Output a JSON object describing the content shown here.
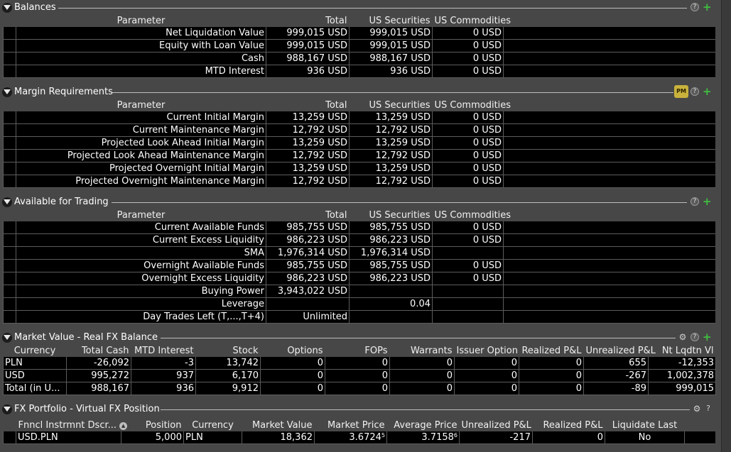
{
  "balances": {
    "title": "Balances",
    "headers": [
      "Parameter",
      "Total",
      "US Securities",
      "US Commodities"
    ],
    "rows": [
      [
        "Net Liquidation Value",
        "999,015 USD",
        "999,015 USD",
        "0 USD"
      ],
      [
        "Equity with Loan Value",
        "999,015 USD",
        "999,015 USD",
        "0 USD"
      ],
      [
        "Cash",
        "988,167 USD",
        "988,167 USD",
        "0 USD"
      ],
      [
        "MTD Interest",
        "936 USD",
        "936 USD",
        "0 USD"
      ]
    ]
  },
  "margin": {
    "title": "Margin Requirements",
    "try_label": "PM",
    "headers": [
      "Parameter",
      "Total",
      "US Securities",
      "US Commodities"
    ],
    "rows": [
      [
        "Current Initial Margin",
        "13,259 USD",
        "13,259 USD",
        "0 USD"
      ],
      [
        "Current Maintenance Margin",
        "12,792 USD",
        "12,792 USD",
        "0 USD"
      ],
      [
        "Projected Look Ahead Initial Margin",
        "13,259 USD",
        "13,259 USD",
        "0 USD"
      ],
      [
        "Projected Look Ahead Maintenance Margin",
        "12,792 USD",
        "12,792 USD",
        "0 USD"
      ],
      [
        "Projected Overnight Initial Margin",
        "13,259 USD",
        "13,259 USD",
        "0 USD"
      ],
      [
        "Projected Overnight Maintenance Margin",
        "12,792 USD",
        "12,792 USD",
        "0 USD"
      ]
    ]
  },
  "available": {
    "title": "Available for Trading",
    "headers": [
      "Parameter",
      "Total",
      "US Securities",
      "US Commodities"
    ],
    "rows": [
      [
        "Current Available Funds",
        "985,755 USD",
        "985,755 USD",
        "0 USD"
      ],
      [
        "Current Excess Liquidity",
        "986,223 USD",
        "986,223 USD",
        "0 USD"
      ],
      [
        "SMA",
        "1,976,314 USD",
        "1,976,314 USD",
        ""
      ],
      [
        "Overnight Available Funds",
        "985,755 USD",
        "985,755 USD",
        "0 USD"
      ],
      [
        "Overnight Excess Liquidity",
        "986,223 USD",
        "986,223 USD",
        "0 USD"
      ],
      [
        "Buying Power",
        "3,943,022 USD",
        "",
        ""
      ],
      [
        "Leverage",
        "",
        "0.04",
        ""
      ],
      [
        "Day Trades Left (T,...,T+4)",
        "Unlimited",
        "",
        ""
      ]
    ]
  },
  "market": {
    "title": "Market Value - Real FX Balance",
    "headers": [
      "Currency",
      "Total Cash",
      "MTD Interest",
      "Stock",
      "Options",
      "FOPs",
      "Warrants",
      "Issuer Option",
      "Realized P&L",
      "Unrealized P&L",
      "Nt Lqdtn Vl"
    ],
    "rows": [
      [
        "PLN",
        "-26,092",
        "-3",
        "13,742",
        "0",
        "0",
        "0",
        "0",
        "0",
        "655",
        "-12,353"
      ],
      [
        "USD",
        "995,272",
        "937",
        "6,170",
        "0",
        "0",
        "0",
        "0",
        "0",
        "-267",
        "1,002,378"
      ],
      [
        "Total (in U...",
        "988,167",
        "936",
        "9,912",
        "0",
        "0",
        "0",
        "0",
        "0",
        "-89",
        "999,015"
      ]
    ]
  },
  "fx": {
    "title": "FX Portfolio - Virtual FX Position",
    "headers": [
      "Fnncl Instrmnt Dscr...",
      "Position",
      "Currency",
      "Market Value",
      "Market Price",
      "Average Price",
      "Unrealized P&L",
      "Realized P&L",
      "Liquidate Last"
    ],
    "row": {
      "instrument": "USD.PLN",
      "position": "5,000",
      "currency": "PLN",
      "market_value": "18,362",
      "market_price": "3.6724",
      "market_price_sup": "5",
      "average_price": "3.7158",
      "average_price_sup": "6",
      "unrealized": "-217",
      "realized": "0",
      "liquidate_last": "No"
    }
  },
  "icons": {
    "help": "?",
    "add": "+",
    "gear": "⚙",
    "question": "?",
    "sort": "▲",
    "collapse": "collapse-triangle"
  }
}
